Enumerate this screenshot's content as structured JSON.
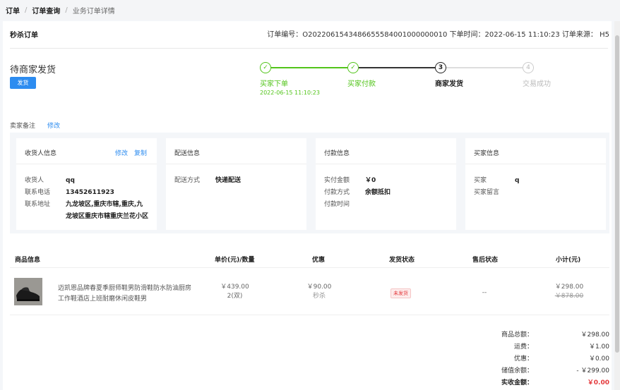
{
  "breadcrumb": {
    "items": [
      "订单",
      "订单查询",
      "业务订单详情"
    ]
  },
  "header": {
    "order_type": "秒杀订单",
    "meta": "订单编号：O2022061543486655584001000000010 下单时间：2022-06-15 11:10:23 订单来源： H5"
  },
  "status": {
    "title": "待商家发货",
    "ship_button": "发货"
  },
  "steps": [
    {
      "num": "1",
      "label": "买家下单",
      "time": "2022-06-15 11:10:23",
      "state": "done"
    },
    {
      "num": "2",
      "label": "买家付款",
      "state": "done"
    },
    {
      "num": "3",
      "label": "商家发货",
      "state": "current"
    },
    {
      "num": "4",
      "label": "交易成功",
      "state": "todo"
    }
  ],
  "remark": {
    "label": "卖家备注",
    "edit": "修改"
  },
  "cards": {
    "receiver": {
      "title": "收货人信息",
      "edit": "修改",
      "copy": "复制",
      "rows": [
        {
          "k": "收货人",
          "v": "qq"
        },
        {
          "k": "联系电话",
          "v": "13452611923"
        },
        {
          "k": "联系地址",
          "v": "九龙坡区,重庆市辖,重庆,九龙坡区重庆市辖重庆兰花小区"
        }
      ]
    },
    "delivery": {
      "title": "配送信息",
      "rows": [
        {
          "k": "配送方式",
          "v": "快递配送"
        }
      ]
    },
    "payment": {
      "title": "付款信息",
      "rows": [
        {
          "k": "实付金额",
          "v": "￥0"
        },
        {
          "k": "付款方式",
          "v": "余额抵扣"
        },
        {
          "k": "付款时间",
          "v": ""
        }
      ]
    },
    "buyer": {
      "title": "买家信息",
      "rows": [
        {
          "k": "买家",
          "v": "q"
        },
        {
          "k": "买家留言",
          "v": ""
        }
      ]
    }
  },
  "table": {
    "headers": [
      "商品信息",
      "单价(元)/数量",
      "优惠",
      "发货状态",
      "售后状态",
      "小计(元)"
    ],
    "row": {
      "name": "迈凯恩品牌春夏季厨师鞋男防滑鞋防水防油厨房工作鞋酒店上班耐磨休闲皮鞋男",
      "price": "￥439.00",
      "qty": "2(双)",
      "discount": "￥90.00",
      "discount_type": "秒杀",
      "ship_status": "未发货",
      "after_sale": "--",
      "subtotal": "￥298.00",
      "original": "￥878.00"
    }
  },
  "summary": [
    {
      "k": "商品总额：",
      "v": "￥298.00"
    },
    {
      "k": "运费：",
      "v": "￥1.00"
    },
    {
      "k": "优惠：",
      "v": "￥0.00"
    },
    {
      "k": "储值余额：",
      "v": "- ￥299.00"
    },
    {
      "k": "实收金额：",
      "v": "￥0.00"
    }
  ],
  "colors": {
    "accent": "#2d8cf0",
    "success": "#52c41a",
    "danger": "#e4393c"
  }
}
